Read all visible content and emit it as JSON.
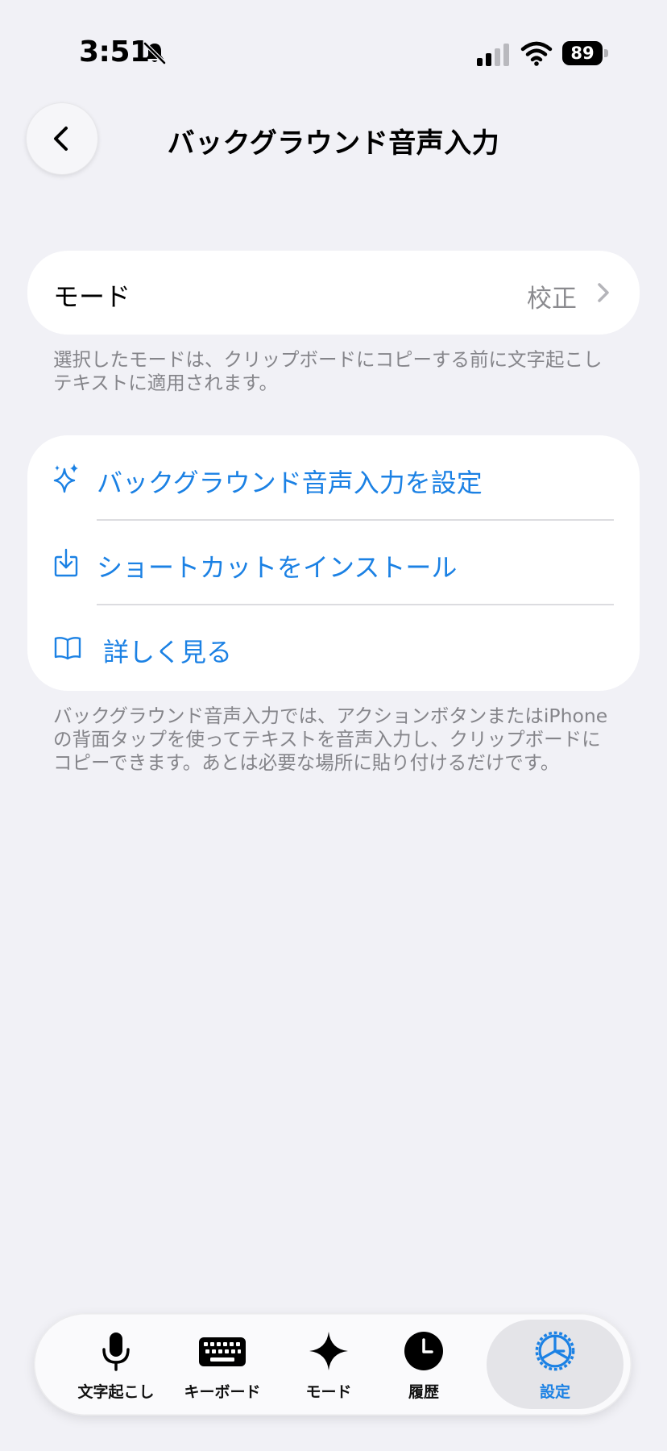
{
  "status_bar": {
    "time": "3:51",
    "battery": "89"
  },
  "header": {
    "title": "バックグラウンド音声入力"
  },
  "mode_card": {
    "label": "モード",
    "value": "校正"
  },
  "mode_footnote": "選択したモードは、クリップボードにコピーする前に文字起こしテキストに適用されます。",
  "actions": [
    {
      "label": "バックグラウンド音声入力を設定",
      "icon": "sparkle-icon"
    },
    {
      "label": "ショートカットをインストール",
      "icon": "download-icon"
    },
    {
      "label": "詳しく見る",
      "icon": "book-icon"
    }
  ],
  "actions_footnote": "バックグラウンド音声入力では、アクションボタンまたはiPhoneの背面タップを使ってテキストを音声入力し、クリップボードにコピーできます。あとは必要な場所に貼り付けるだけです。",
  "tab_bar": {
    "tabs": [
      {
        "label": "文字起こし",
        "icon": "microphone-icon"
      },
      {
        "label": "キーボード",
        "icon": "keyboard-icon"
      },
      {
        "label": "モード",
        "icon": "sparkle-icon"
      },
      {
        "label": "履歴",
        "icon": "clock-icon"
      },
      {
        "label": "設定",
        "icon": "gear-icon",
        "selected": true
      }
    ]
  },
  "colors": {
    "accent": "#1b81e4",
    "background": "#f1f1f6",
    "secondary_text": "#85858a"
  }
}
